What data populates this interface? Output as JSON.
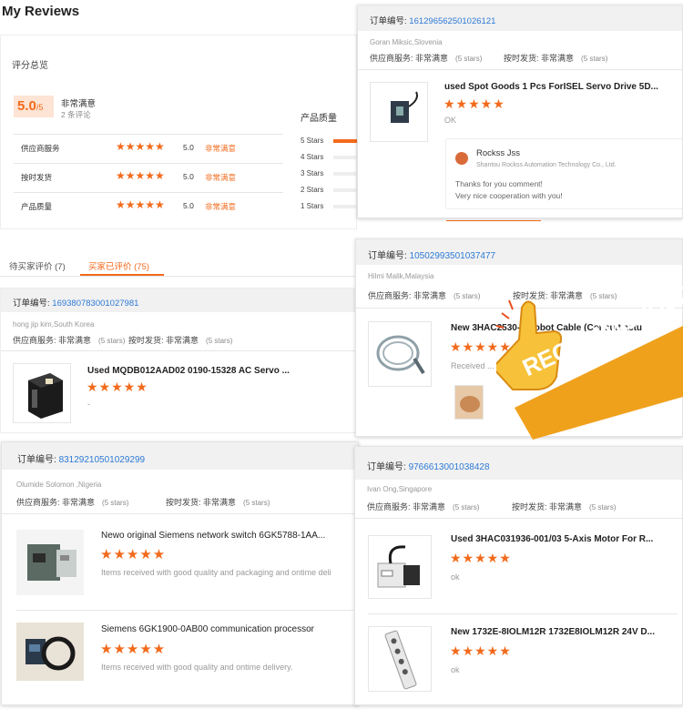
{
  "header": {
    "title": "My Reviews"
  },
  "summary": {
    "heading": "评分总览",
    "score": "5.0",
    "score_suffix": "/5",
    "score_label": "非常满意",
    "review_count": "2 条评论",
    "rows": [
      {
        "label": "供应商服务",
        "value": "5.0",
        "status": "非常满意"
      },
      {
        "label": "按时发货",
        "value": "5.0",
        "status": "非常满意"
      },
      {
        "label": "产品质量",
        "value": "5.0",
        "status": "非常满意"
      }
    ],
    "quality_heading": "产品质量",
    "distribution": [
      {
        "label": "5 Stars",
        "fraction": 1.0
      },
      {
        "label": "4 Stars",
        "fraction": 0
      },
      {
        "label": "3 Stars",
        "fraction": 0
      },
      {
        "label": "2 Stars",
        "fraction": 0
      },
      {
        "label": "1 Stars",
        "fraction": 0
      }
    ]
  },
  "tabs": [
    {
      "label": "待买家评价 (7)",
      "active": false
    },
    {
      "label": "买家已评价 (75)",
      "active": true
    }
  ],
  "labels": {
    "order_prefix": "订单编号:",
    "supplier_service": "供应商服务:",
    "on_time": "按时发货:",
    "very_satisfied": "非常满意",
    "five_stars": "(5 stars)",
    "stars": "★★★★★"
  },
  "orders": [
    {
      "order_no": "1693807830010279​81",
      "buyer": "hong jip kim,South Korea",
      "items": [
        {
          "title": "Used MQDB012AAD02 0190-15328 AC Servo ...",
          "comment": "-"
        }
      ]
    },
    {
      "order_no": "83129210501029299",
      "buyer": "Olumide Solomon ,Nigeria",
      "items": [
        {
          "title": "Newo original Siemens network switch 6GK5788-1AA...",
          "comment": "Items received with good quality and packaging and ontime deli"
        },
        {
          "title": "Siemens 6GK1900-0AB00 communication processor",
          "comment": "Items received with good quality and ontime delivery."
        }
      ]
    },
    {
      "order_no": "161296562501026121",
      "buyer": "Goran Miksic,Slovenia",
      "items": [
        {
          "title": "used Spot Goods 1 Pcs ForISEL Servo Drive 5D...",
          "comment": "OK"
        }
      ],
      "reply": {
        "name": "Rockss Jss",
        "company": "Shantou Rockss Automation Technology Co., Ltd.",
        "lines": [
          "Thanks for you comment!",
          "Very nice cooperation with you!"
        ]
      }
    },
    {
      "order_no": "10502993501037477",
      "buyer": "Hilmi Malik,Malaysia",
      "items": [
        {
          "title": "New 3HAC2530-1 Robot Cable (Consult actu",
          "comment": "Received ... packaging"
        }
      ]
    },
    {
      "order_no": "97666130010384​28",
      "buyer": "Ivan Ong,Singapore",
      "items": [
        {
          "title": "Used 3HAC031936-001/03 5-Axis Motor For R...",
          "comment": "ok"
        },
        {
          "title": "New 1732E-8IOLM12R 1732E8IOLM12R 24V D...",
          "comment": "ok"
        }
      ]
    }
  ],
  "badge": {
    "text": "RECOMMENDED"
  },
  "colors": {
    "accent": "#f26a1b",
    "link": "#2d7ad6",
    "badge": "#f0a11c"
  }
}
